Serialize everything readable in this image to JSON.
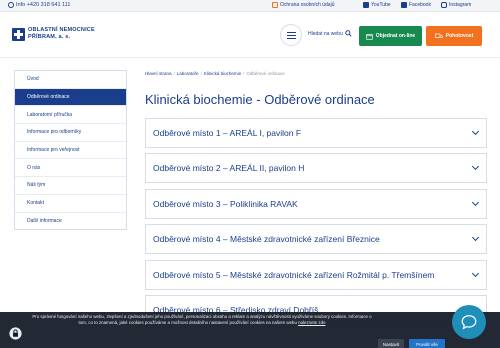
{
  "topbar": {
    "info": "Info +420 318 641 111",
    "privacy": "Ochrana osobních údajů",
    "youtube": "YouTube",
    "facebook": "Facebook",
    "instagram": "Instagram"
  },
  "header": {
    "logo_line1": "OBLASTNÍ NEMOCNICE",
    "logo_line2": "PŘÍBRAM, a. s.",
    "search_label": "Hledat na webu",
    "btn_order": "Objednat on-line",
    "btn_emergency": "Pohotovost"
  },
  "sidebar": {
    "items": [
      {
        "label": "Úvod"
      },
      {
        "label": "Odběrové ordinace"
      },
      {
        "label": "Laboratorní příručka"
      },
      {
        "label": "Informace pro odborníky"
      },
      {
        "label": "Informace pro veřejnost"
      },
      {
        "label": "O nás"
      },
      {
        "label": "Náš tým"
      },
      {
        "label": "Kontakt"
      },
      {
        "label": "Další informace"
      }
    ]
  },
  "breadcrumb": {
    "items": [
      "Hlavní strana",
      "Laboratoře",
      "Klinická biochemie",
      "Odběrové ordinace"
    ],
    "separator": "/"
  },
  "main": {
    "title": "Klinická biochemie - Odběrové ordinace",
    "accordion": [
      {
        "label": "Odběrové místo 1 – AREÁL I, pavilon F"
      },
      {
        "label": "Odběrové místo 2 – AREÁL II, pavilon H"
      },
      {
        "label": "Odběrové místo 3 – Poliklinika RAVAK"
      },
      {
        "label": "Odběrové místo 4 – Městské zdravotnické zařízení Březnice"
      },
      {
        "label": "Odběrové místo 5 – Městské zdravotnické zařízení Rožmitál p. Třemšínem"
      },
      {
        "label": "Odběrové místo 6 – Středisko zdraví Dobříš"
      }
    ]
  },
  "cookie": {
    "text": "Pro správné fungování našeho webu, zlepšení a zjednodušení jeho používání, personalizaci obsahu a reklam a analýzu návštěvnosti využíváme soubory cookies. Informace o tom, co to znamená, jaké cookies používáme a možnost detailního nastavení používání cookies na našem webu",
    "link": "naleznete zde",
    "btn_settings": "Nastavit",
    "btn_allow": "Povolit vše"
  },
  "colors": {
    "brand_blue": "#1a3e8c",
    "green": "#198a4f",
    "orange": "#f2711f",
    "chat": "#1f8fb9"
  }
}
